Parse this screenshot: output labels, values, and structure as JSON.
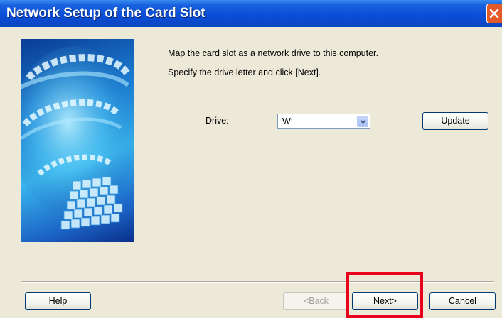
{
  "window": {
    "title": "Network Setup of the Card Slot",
    "close_icon": "close-icon"
  },
  "content": {
    "description_line1": "Map the card slot as a network drive to this computer.",
    "description_line2": "Specify the drive letter and click [Next]."
  },
  "drive": {
    "label": "Drive:",
    "selected": "W:",
    "dropdown_icon": "chevron-down-icon"
  },
  "buttons": {
    "update": "Update",
    "help": "Help",
    "back": "<Back",
    "next": "Next>",
    "cancel": "Cancel"
  },
  "colors": {
    "titlebar": "#0a4ed8",
    "close_button": "#e35a2a",
    "dialog_background": "#ece9d8",
    "highlight_box": "#e8001c"
  }
}
